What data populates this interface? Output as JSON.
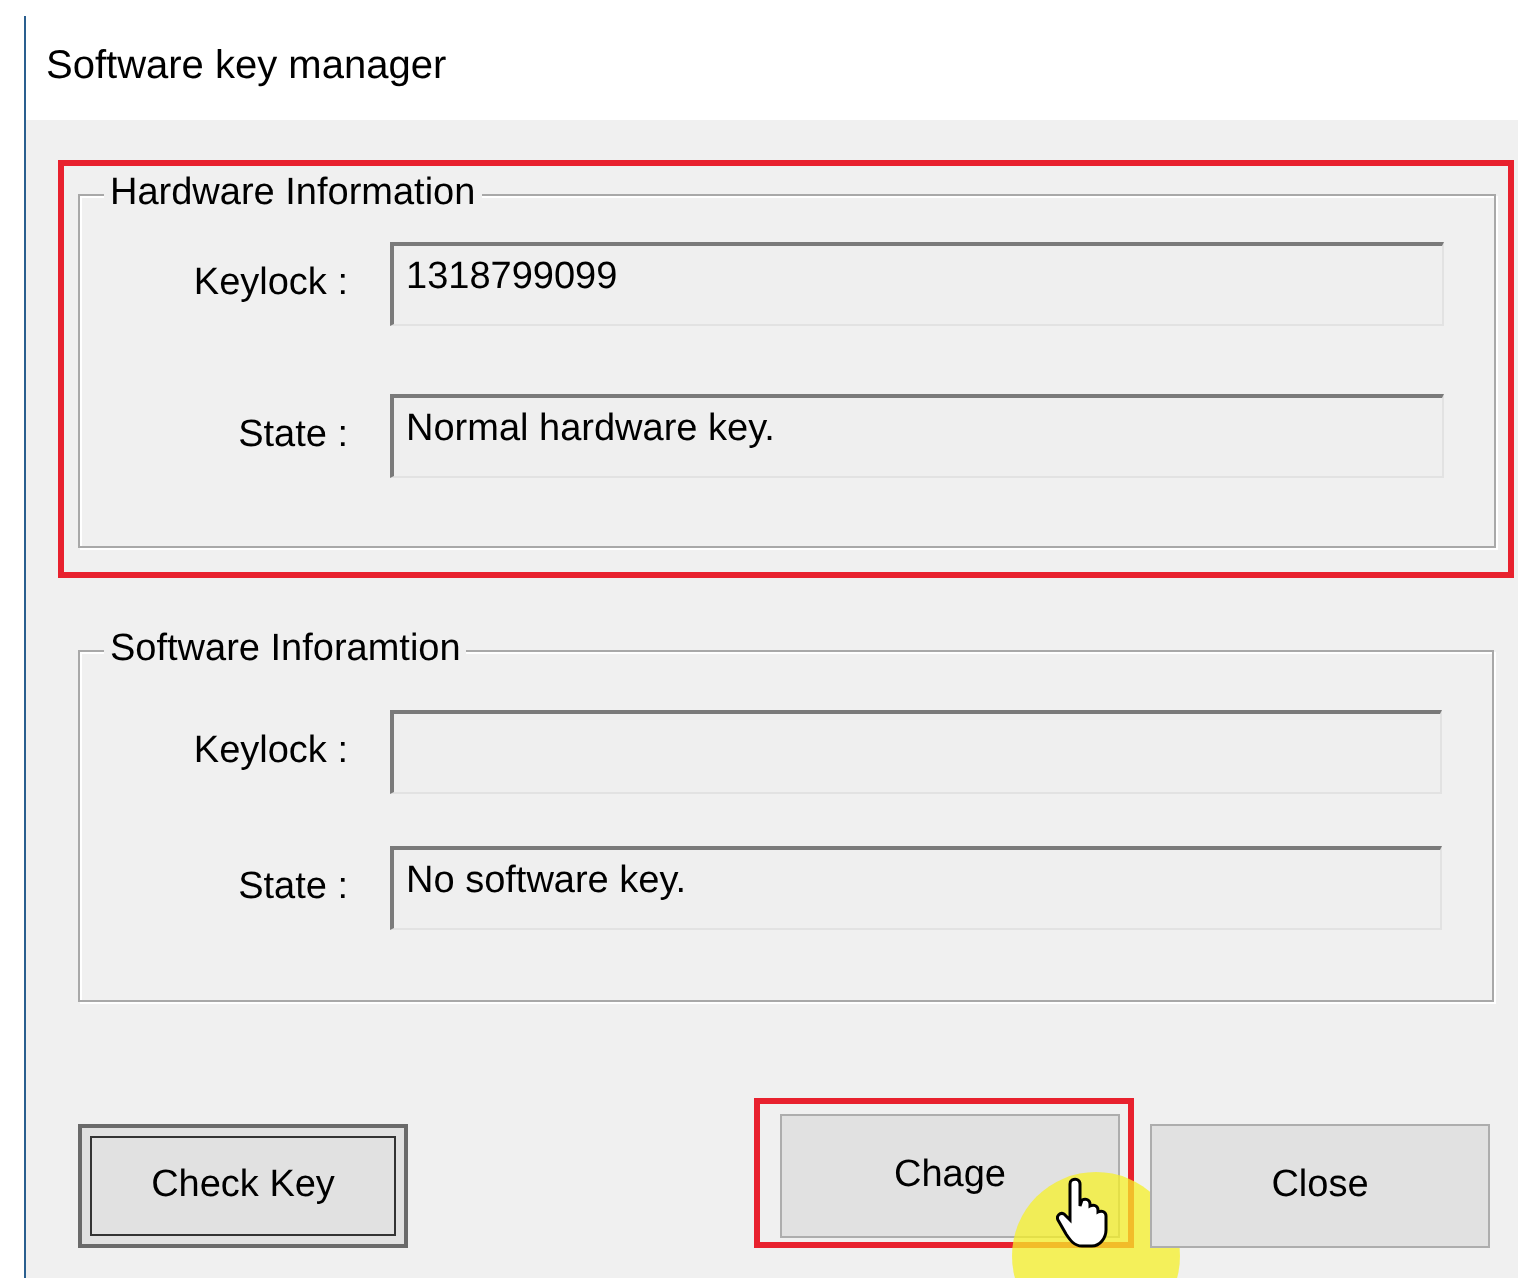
{
  "window": {
    "title": "Software key manager"
  },
  "groups": [
    {
      "title": "Hardware Information",
      "highlighted": true,
      "fields": [
        {
          "label": "Keylock :",
          "value": "1318799099"
        },
        {
          "label": "State :",
          "value": "Normal hardware key."
        }
      ]
    },
    {
      "title": "Software Inforamtion",
      "highlighted": false,
      "fields": [
        {
          "label": "Keylock :"
        },
        {
          "label": "State :",
          "value": "No software key."
        }
      ]
    }
  ],
  "buttons": [
    {
      "label": "Check Key",
      "focused": true,
      "highlighted": false,
      "cursor": false
    },
    {
      "label": "Chage",
      "focused": false,
      "highlighted": true,
      "cursor": true
    },
    {
      "label": "Close",
      "focused": false,
      "highlighted": false,
      "cursor": false
    }
  ]
}
